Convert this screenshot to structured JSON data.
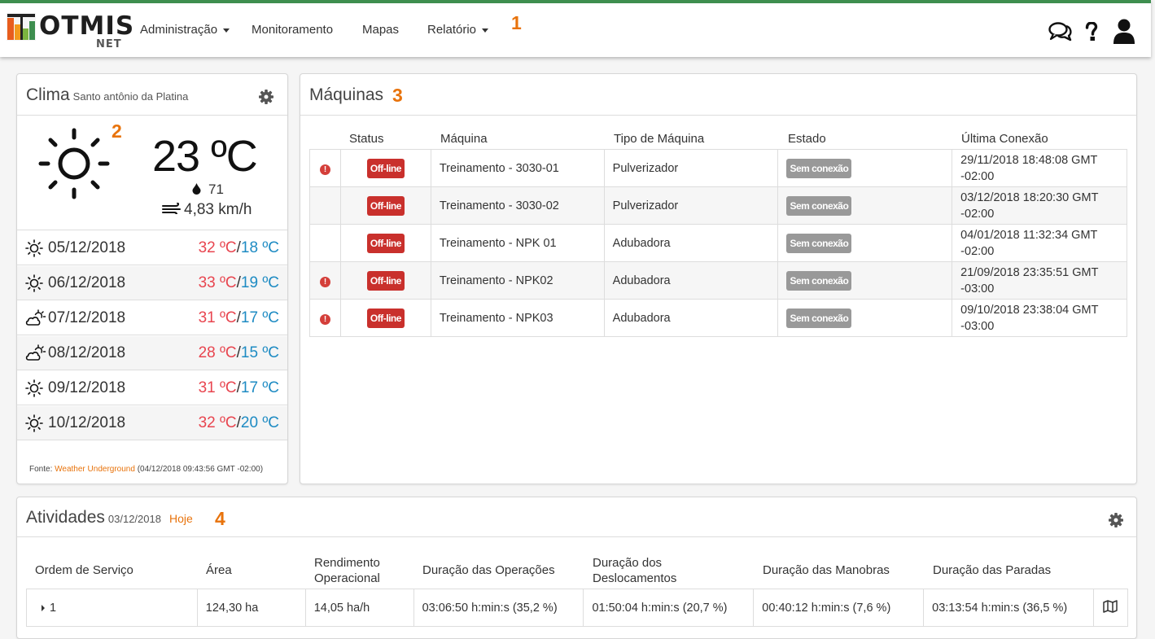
{
  "navbar": {
    "brand": "OTMIS",
    "brand_sub": "NET",
    "menu": [
      {
        "label": "Administração",
        "dropdown": true
      },
      {
        "label": "Monitoramento",
        "dropdown": false
      },
      {
        "label": "Mapas",
        "dropdown": false
      },
      {
        "label": "Relatório",
        "dropdown": true
      }
    ],
    "marker": "1",
    "icons": [
      "chat-icon",
      "help-icon",
      "user-icon"
    ],
    "accent_color": "#3e8e4f"
  },
  "clima": {
    "title": "Clima",
    "location": "Santo antônio da Platina",
    "marker": "2",
    "current": {
      "temperature": "23 ºC",
      "humidity": "71",
      "wind": "4,83 km/h",
      "icon": "sun-icon"
    },
    "forecast": [
      {
        "date": "05/12/2018",
        "max": "32 ºC",
        "min": "18 ºC",
        "icon": "sun-icon"
      },
      {
        "date": "06/12/2018",
        "max": "33 ºC",
        "min": "19 ºC",
        "icon": "sun-icon"
      },
      {
        "date": "07/12/2018",
        "max": "31 ºC",
        "min": "17 ºC",
        "icon": "partly-cloudy-icon"
      },
      {
        "date": "08/12/2018",
        "max": "28 ºC",
        "min": "15 ºC",
        "icon": "partly-cloudy-icon"
      },
      {
        "date": "09/12/2018",
        "max": "31 ºC",
        "min": "17 ºC",
        "icon": "sun-icon"
      },
      {
        "date": "10/12/2018",
        "max": "32 ºC",
        "min": "20 ºC",
        "icon": "sun-icon"
      }
    ],
    "separator": "/",
    "source_prefix": "Fonte:",
    "source_link": "Weather Underground",
    "source_time": "(04/12/2018 09:43:56 GMT -02:00)",
    "max_color": "#e8454f",
    "min_color": "#1e8bc3"
  },
  "maquinas": {
    "title": "Máquinas",
    "marker": "3",
    "columns": [
      "Status",
      "Máquina",
      "Tipo de Máquina",
      "Estado",
      "Última Conexão"
    ],
    "rows": [
      {
        "alert": true,
        "status": "Off-line",
        "machine": "Treinamento - 3030-01",
        "type": "Pulverizador",
        "state": "Sem conexão",
        "last_line1": "29/11/2018 18:48:08 GMT",
        "last_line2": "-02:00"
      },
      {
        "alert": false,
        "status": "Off-line",
        "machine": "Treinamento - 3030-02",
        "type": "Pulverizador",
        "state": "Sem conexão",
        "last_line1": "03/12/2018 18:20:30 GMT",
        "last_line2": "-02:00"
      },
      {
        "alert": false,
        "status": "Off-line",
        "machine": "Treinamento - NPK 01",
        "type": "Adubadora",
        "state": "Sem conexão",
        "last_line1": "04/01/2018 11:32:34 GMT",
        "last_line2": "-02:00"
      },
      {
        "alert": true,
        "status": "Off-line",
        "machine": "Treinamento - NPK02",
        "type": "Adubadora",
        "state": "Sem conexão",
        "last_line1": "21/09/2018 23:35:51 GMT",
        "last_line2": "-03:00"
      },
      {
        "alert": true,
        "status": "Off-line",
        "machine": "Treinamento - NPK03",
        "type": "Adubadora",
        "state": "Sem conexão",
        "last_line1": "09/10/2018 23:38:04 GMT",
        "last_line2": "-03:00"
      }
    ],
    "alert_glyph": "!"
  },
  "atividades": {
    "title": "Atividades",
    "date": "03/12/2018",
    "today_link": "Hoje",
    "marker": "4",
    "columns": [
      {
        "line1": "Ordem de Serviço",
        "line2": ""
      },
      {
        "line1": "Área",
        "line2": ""
      },
      {
        "line1": "Rendimento",
        "line2": "Operacional"
      },
      {
        "line1": "Duração das Operações",
        "line2": ""
      },
      {
        "line1": "Duração dos",
        "line2": "Deslocamentos"
      },
      {
        "line1": "Duração das Manobras",
        "line2": ""
      },
      {
        "line1": "Duração das Paradas",
        "line2": ""
      }
    ],
    "row": {
      "order": "1",
      "area": "124,30 ha",
      "rendimento": "14,05 ha/h",
      "operacoes": "03:06:50 h:min:s (35,2 %)",
      "deslocamentos": "01:50:04 h:min:s (20,7 %)",
      "manobras": "00:40:12 h:min:s (7,6 %)",
      "paradas": "03:13:54 h:min:s (36,5 %)",
      "map_icon": "map-icon"
    }
  }
}
